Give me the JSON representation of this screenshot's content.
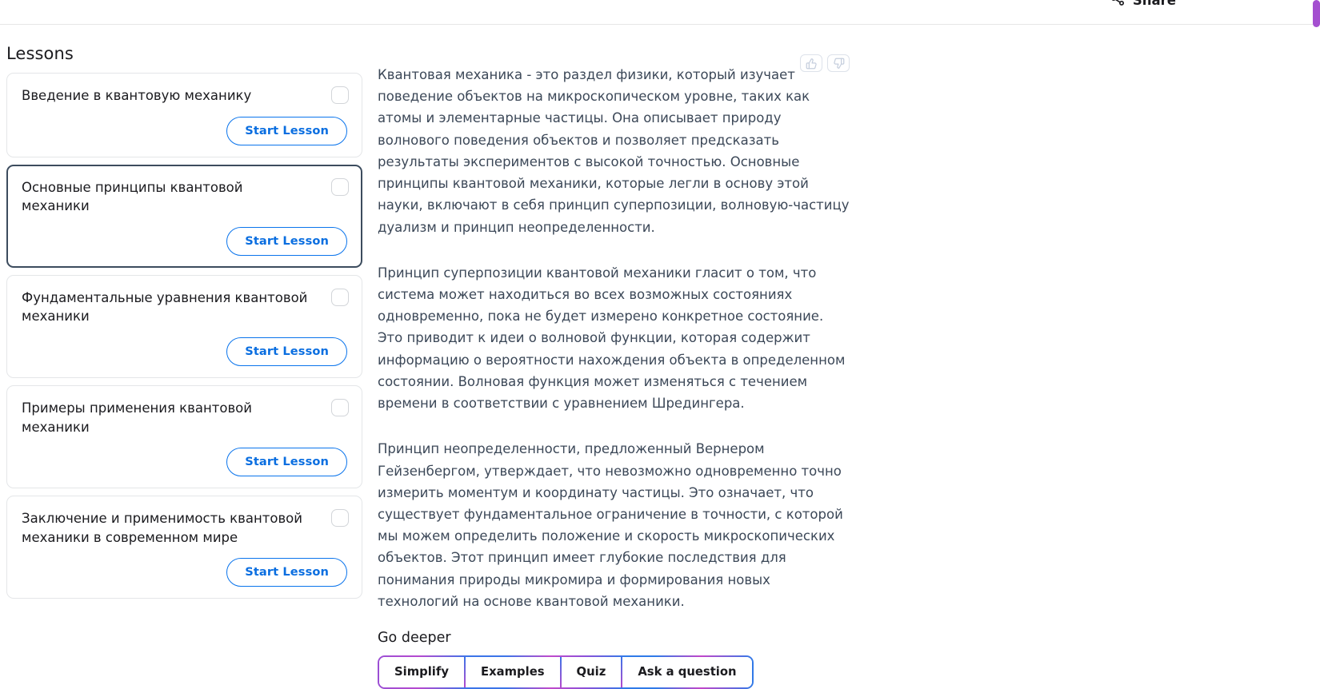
{
  "header": {
    "share_label": "Share",
    "share_icon": "share-icon"
  },
  "scrollbar": {
    "thumb_color": "#a44fd0"
  },
  "sidebar": {
    "title": "Lessons",
    "lessons": [
      {
        "name": "Введение в квантовую механику",
        "button_label": "Start Lesson",
        "selected": false,
        "checked": false
      },
      {
        "name": "Основные принципы квантовой механики",
        "button_label": "Start Lesson",
        "selected": true,
        "checked": false
      },
      {
        "name": "Фундаментальные уравнения квантовой механики",
        "button_label": "Start Lesson",
        "selected": false,
        "checked": false
      },
      {
        "name": "Примеры применения квантовой механики",
        "button_label": "Start Lesson",
        "selected": false,
        "checked": false
      },
      {
        "name": "Заключение и применимость квантовой механики в современном мире",
        "button_label": "Start Lesson",
        "selected": false,
        "checked": false
      }
    ]
  },
  "content": {
    "feedback": {
      "thumbs_up_icon": "thumbs-up-icon",
      "thumbs_down_icon": "thumbs-down-icon"
    },
    "paragraphs": [
      "Квантовая механика - это раздел физики, который изучает поведение объектов на микроскопическом уровне, таких как атомы и элементарные частицы. Она описывает природу волнового поведения объектов и позволяет предсказать результаты экспериментов с высокой точностью. Основные принципы квантовой механики, которые легли в основу этой науки, включают в себя принцип суперпозиции, волновую-частицу дуализм и принцип неопределенности.",
      "Принцип суперпозиции квантовой механики гласит о том, что система может находиться во всех возможных состояниях одновременно, пока не будет измерено конкретное состояние. Это приводит к идеи о волновой функции, которая содержит информацию о вероятности нахождения объекта в определенном состоянии. Волновая функция может изменяться с течением времени в соответствии с уравнением Шредингера.",
      "Принцип неопределенности, предложенный Вернером Гейзенбергом, утверждает, что невозможно одновременно точно измерить моментум и координату частицы. Это означает, что существует фундаментальное ограничение в точности, с которой мы можем определить положение и скорость микроскопических объектов. Этот принцип имеет глубокие последствия для понимания природы микромира и формирования новых технологий на основе квантовой механики."
    ],
    "go_deeper": {
      "title": "Go deeper",
      "actions": [
        "Simplify",
        "Examples",
        "Quiz",
        "Ask a question"
      ]
    }
  },
  "colors": {
    "accent_blue": "#0a74ec",
    "selected_border": "#3c4c5e",
    "gradient_purple": "#9b4fd4",
    "gradient_blue": "#3b74e8",
    "body_text": "#3c4858"
  }
}
